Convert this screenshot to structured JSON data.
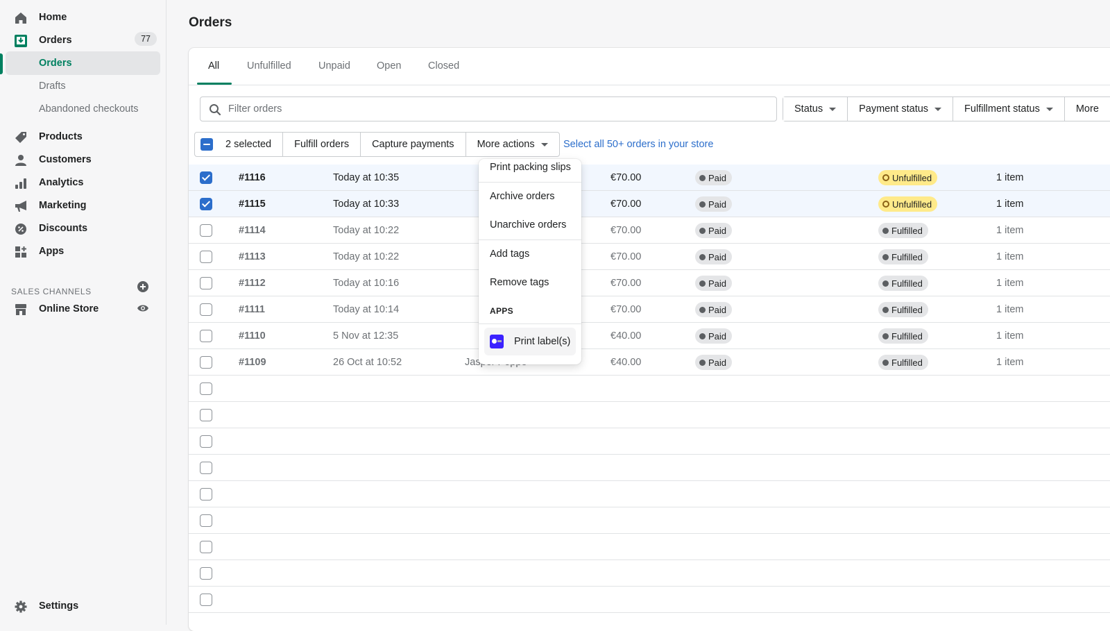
{
  "sidebar": {
    "items": [
      {
        "label": "Home",
        "icon": "home-icon"
      },
      {
        "label": "Orders",
        "icon": "orders-icon",
        "badge": "77"
      },
      {
        "label": "Orders",
        "sub": true,
        "active": true
      },
      {
        "label": "Drafts",
        "sub": true
      },
      {
        "label": "Abandoned checkouts",
        "sub": true
      },
      {
        "label": "Products",
        "icon": "tag-icon"
      },
      {
        "label": "Customers",
        "icon": "person-icon"
      },
      {
        "label": "Analytics",
        "icon": "bar-chart-icon"
      },
      {
        "label": "Marketing",
        "icon": "megaphone-icon"
      },
      {
        "label": "Discounts",
        "icon": "discount-icon"
      },
      {
        "label": "Apps",
        "icon": "apps-icon"
      }
    ],
    "sales_channels_title": "SALES CHANNELS",
    "online_store": "Online Store",
    "settings": "Settings"
  },
  "page": {
    "title": "Orders"
  },
  "tabs": [
    "All",
    "Unfulfilled",
    "Unpaid",
    "Open",
    "Closed"
  ],
  "search": {
    "placeholder": "Filter orders"
  },
  "filters": [
    "Status",
    "Payment status",
    "Fulfillment status",
    "More"
  ],
  "bulk": {
    "selected": "2 selected",
    "fulfill": "Fulfill orders",
    "capture": "Capture payments",
    "more": "More actions",
    "select_all": "Select all 50+ orders in your store"
  },
  "menu": {
    "items": [
      "Print packing slips",
      "Archive orders",
      "Unarchive orders",
      "Add tags",
      "Remove tags"
    ],
    "apps_header": "APPS",
    "app_item": "Print label(s)"
  },
  "orders": [
    {
      "num": "#1116",
      "date": "Today at 10:35",
      "customer": "",
      "total": "€70.00",
      "payment": "Paid",
      "fulfillment": "Unfulfilled",
      "items": "1 item",
      "selected": true
    },
    {
      "num": "#1115",
      "date": "Today at 10:33",
      "customer": "",
      "total": "€70.00",
      "payment": "Paid",
      "fulfillment": "Unfulfilled",
      "items": "1 item",
      "selected": true
    },
    {
      "num": "#1114",
      "date": "Today at 10:22",
      "customer": "",
      "total": "€70.00",
      "payment": "Paid",
      "fulfillment": "Fulfilled",
      "items": "1 item",
      "selected": false
    },
    {
      "num": "#1113",
      "date": "Today at 10:22",
      "customer": "",
      "total": "€70.00",
      "payment": "Paid",
      "fulfillment": "Fulfilled",
      "items": "1 item",
      "selected": false
    },
    {
      "num": "#1112",
      "date": "Today at 10:16",
      "customer": "",
      "total": "€70.00",
      "payment": "Paid",
      "fulfillment": "Fulfilled",
      "items": "1 item",
      "selected": false
    },
    {
      "num": "#1111",
      "date": "Today at 10:14",
      "customer": "",
      "total": "€70.00",
      "payment": "Paid",
      "fulfillment": "Fulfilled",
      "items": "1 item",
      "selected": false
    },
    {
      "num": "#1110",
      "date": "5 Nov at 12:35",
      "customer": "",
      "total": "€40.00",
      "payment": "Paid",
      "fulfillment": "Fulfilled",
      "items": "1 item",
      "selected": false
    },
    {
      "num": "#1109",
      "date": "26 Oct at 10:52",
      "customer": "Jasper Poppe",
      "total": "€40.00",
      "payment": "Paid",
      "fulfillment": "Fulfilled",
      "items": "1 item",
      "selected": false
    }
  ],
  "empty_rows": 9
}
